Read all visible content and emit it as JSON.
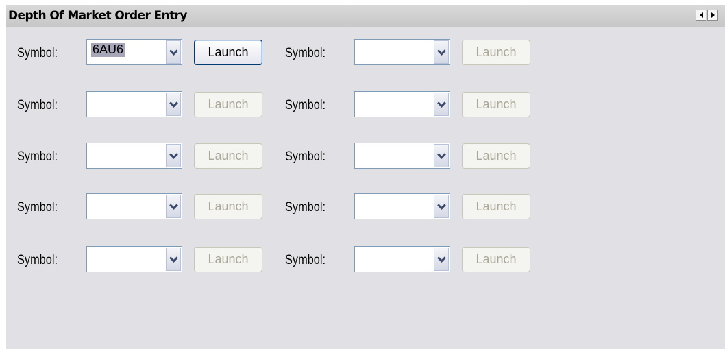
{
  "panel": {
    "title": "Depth Of Market Order Entry",
    "nav": [
      "scroll-left-icon",
      "scroll-right-icon"
    ]
  },
  "rows": [
    {
      "left": {
        "label": "Symbol:",
        "value": "6AU6",
        "launch": "Launch",
        "enabled": true
      },
      "right": {
        "label": "Symbol:",
        "value": "",
        "launch": "Launch",
        "enabled": false
      }
    },
    {
      "left": {
        "label": "Symbol:",
        "value": "",
        "launch": "Launch",
        "enabled": false
      },
      "right": {
        "label": "Symbol:",
        "value": "",
        "launch": "Launch",
        "enabled": false
      }
    },
    {
      "left": {
        "label": "Symbol:",
        "value": "",
        "launch": "Launch",
        "enabled": false
      },
      "right": {
        "label": "Symbol:",
        "value": "",
        "launch": "Launch",
        "enabled": false
      }
    },
    {
      "left": {
        "label": "Symbol:",
        "value": "",
        "launch": "Launch",
        "enabled": false
      },
      "right": {
        "label": "Symbol:",
        "value": "",
        "launch": "Launch",
        "enabled": false
      }
    },
    {
      "left": {
        "label": "Symbol:",
        "value": "",
        "launch": "Launch",
        "enabled": false
      },
      "right": {
        "label": "Symbol:",
        "value": "",
        "launch": "Launch",
        "enabled": false
      }
    }
  ]
}
